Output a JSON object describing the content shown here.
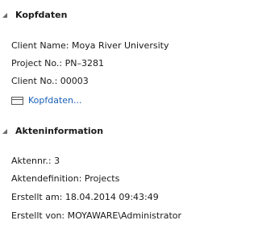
{
  "sections": [
    {
      "title": "Kopfdaten",
      "fields": [
        "Client Name: Moya River University",
        "Project No.: PN–3281",
        "Client No.: 00003"
      ],
      "link": "Kopfdaten..."
    },
    {
      "title": "Akteninformation",
      "fields": [
        "Aktennr.: 3",
        "Aktendefinition: Projects",
        "Erstellt am: 18.04.2014 09:43:49",
        "Erstellt von: MOYAWARE\\Administrator"
      ]
    }
  ],
  "icons": {
    "collapse": "chevron-down-icon",
    "form": "form-icon"
  }
}
